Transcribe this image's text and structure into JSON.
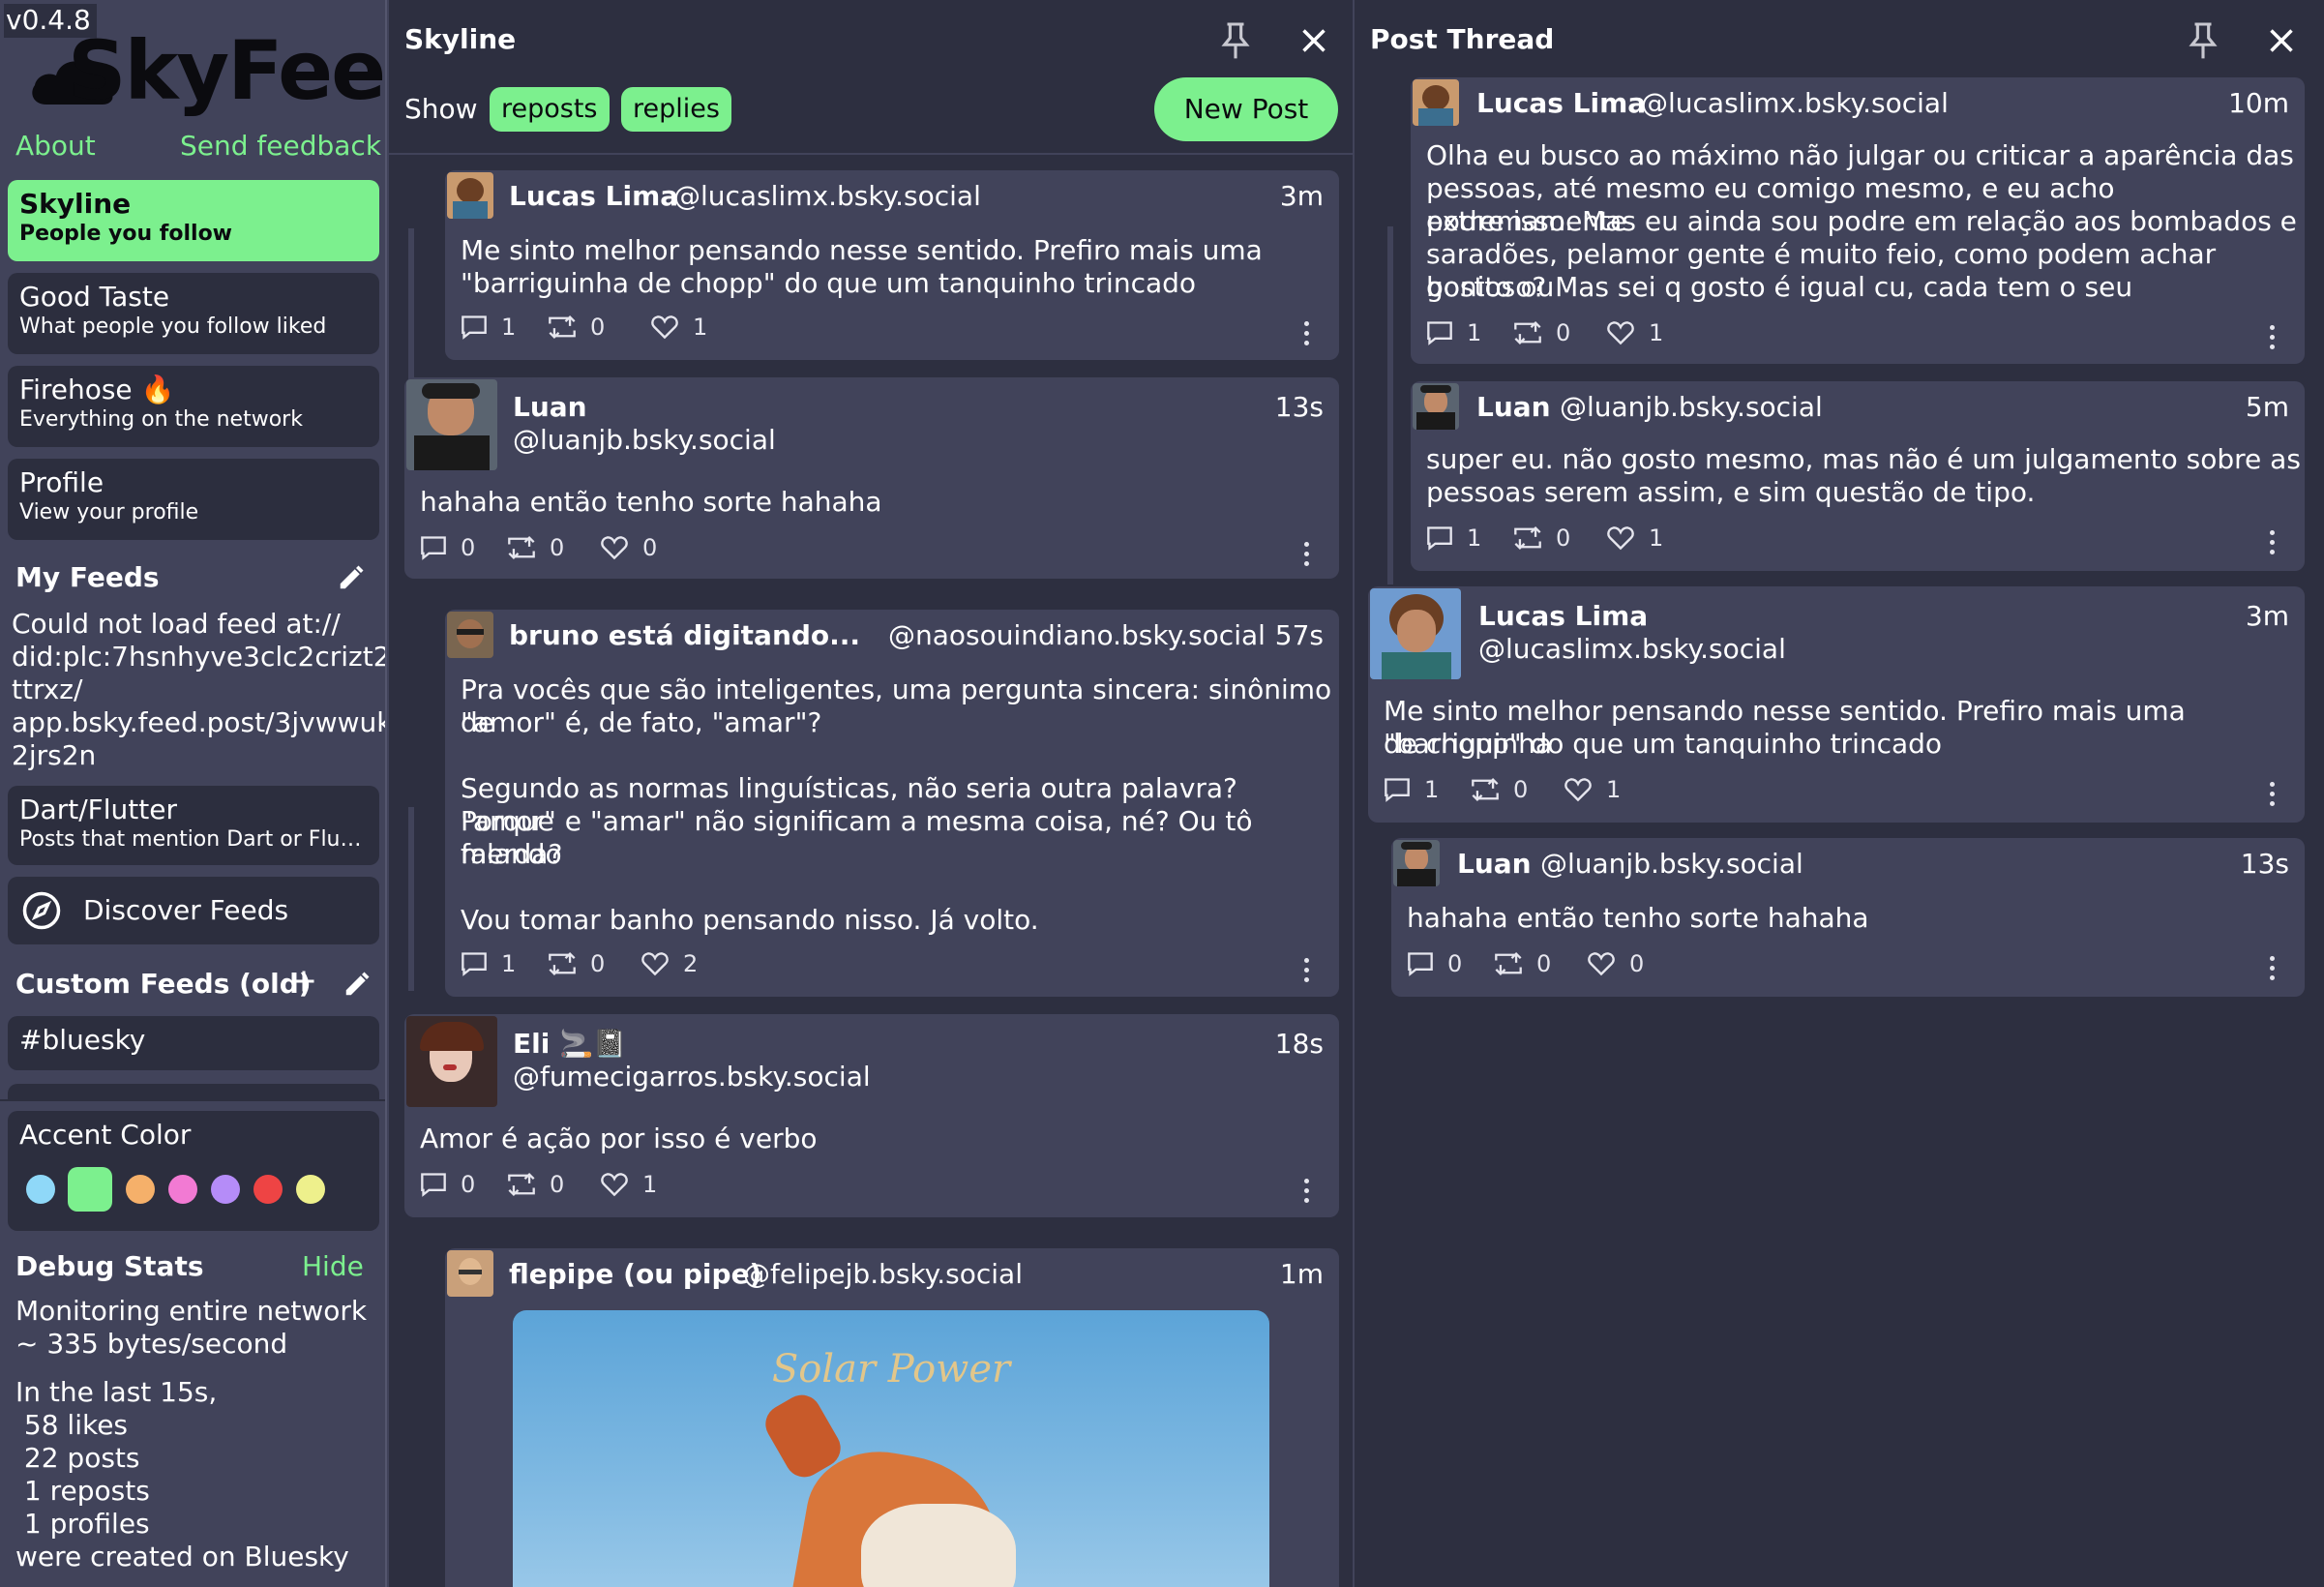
{
  "app": {
    "version": "v0.4.8",
    "logo_text": "SkyFeed",
    "accent_color": "#7cf08e"
  },
  "sidebar": {
    "about": "About",
    "send_feedback": "Send feedback",
    "feeds": [
      {
        "title": "Skyline",
        "subtitle": "People you follow",
        "active": true
      },
      {
        "title": "Good Taste",
        "subtitle": "What people you follow liked"
      },
      {
        "title": "Firehose 🔥",
        "subtitle": "Everything on the network"
      },
      {
        "title": "Profile",
        "subtitle": "View your profile"
      }
    ],
    "my_feeds_title": "My Feeds",
    "feed_error": [
      "Could not load feed at://",
      "did:plc:7hsnhyve3clc2crizt2",
      "ttrxz/",
      "app.bsky.feed.post/3jvwwuk",
      "2jrs2n"
    ],
    "dart_feed": {
      "title": "Dart/Flutter",
      "subtitle": "Posts that mention Dart or Flutt..."
    },
    "discover_feeds": "Discover Feeds",
    "custom_feeds_title": "Custom Feeds (old)",
    "custom_feed_item": "#bluesky",
    "accent_title": "Accent Color",
    "accent_colors": [
      "#8fd8f8",
      "#7cf08e",
      "#f5b06a",
      "#f27ad3",
      "#b58cf8",
      "#ee4444",
      "#eef08c"
    ],
    "debug_title": "Debug Stats",
    "debug_hide": "Hide",
    "debug_lines_1": [
      "Monitoring entire network",
      "~ 335 bytes/second"
    ],
    "debug_lines_2": [
      "In the last 15s,",
      " 58 likes",
      " 22 posts",
      " 1 reposts",
      " 1 profiles",
      "were created on Bluesky"
    ]
  },
  "skyline": {
    "title": "Skyline",
    "show_label": "Show",
    "filter_reposts": "reposts",
    "filter_replies": "replies",
    "new_post": "New Post",
    "posts": [
      {
        "name": "Lucas Lima",
        "handle": "@lucaslimx.bsky.social",
        "time": "3m",
        "lines": [
          "Me sinto melhor pensando nesse sentido. Prefiro mais uma",
          "\"barriguinha de chopp\" do que um tanquinho trincado"
        ],
        "replies": "1",
        "reposts": "0",
        "likes": "1"
      },
      {
        "name": "Luan",
        "handle": "@luanjb.bsky.social",
        "time": "13s",
        "lines": [
          "hahaha então tenho sorte hahaha"
        ],
        "replies": "0",
        "reposts": "0",
        "likes": "0"
      },
      {
        "name": "bruno está digitando...",
        "handle": "@naosouindiano.bsky.social",
        "time": "57s",
        "lines": [
          "Pra vocês que são inteligentes, uma pergunta sincera: sinônimo de",
          "\"amor\" é, de fato, \"amar\"?",
          "",
          "Segundo as normas linguísticas, não seria outra palavra? Porque",
          "\"amor\" e \"amar\" não significam a mesma coisa, né? Ou tô falando",
          "merda?",
          "",
          "Vou tomar banho pensando nisso. Já volto."
        ],
        "replies": "1",
        "reposts": "0",
        "likes": "2"
      },
      {
        "name": "Eli 🚬📓",
        "handle": "@fumecigarros.bsky.social",
        "time": "18s",
        "lines": [
          "Amor é ação por isso é verbo"
        ],
        "replies": "0",
        "reposts": "0",
        "likes": "1"
      },
      {
        "name": "flepipe (ou pipe)",
        "handle": "@felipejb.bsky.social",
        "time": "1m",
        "image_caption": "Solar Power"
      }
    ]
  },
  "thread": {
    "title": "Post Thread",
    "posts": [
      {
        "name": "Lucas Lima",
        "handle": "@lucaslimx.bsky.social",
        "time": "10m",
        "lines": [
          "Olha eu busco ao máximo não julgar ou criticar a aparência das",
          "pessoas, até mesmo eu comigo mesmo, e eu acho extremamente",
          "podre isso. Mas eu ainda sou podre em relação aos bombados e",
          "saradões, pelamor gente é muito feio, como podem achar bonito ou",
          "gostoso? Mas sei q gosto é igual cu, cada tem o seu"
        ],
        "replies": "1",
        "reposts": "0",
        "likes": "1"
      },
      {
        "name": "Luan",
        "handle": "@luanjb.bsky.social",
        "time": "5m",
        "lines": [
          "super eu. não gosto mesmo, mas não é um julgamento sobre as",
          "pessoas serem assim, e sim questão de tipo."
        ],
        "replies": "1",
        "reposts": "0",
        "likes": "1"
      },
      {
        "name": "Lucas Lima",
        "handle": "@lucaslimx.bsky.social",
        "time": "3m",
        "lines": [
          "Me sinto melhor pensando nesse sentido. Prefiro mais uma \"barriguinha",
          "de chopp\" do que um tanquinho trincado"
        ],
        "replies": "1",
        "reposts": "0",
        "likes": "1"
      },
      {
        "name": "Luan",
        "handle": "@luanjb.bsky.social",
        "time": "13s",
        "lines": [
          "hahaha então tenho sorte hahaha"
        ],
        "replies": "0",
        "reposts": "0",
        "likes": "0"
      }
    ]
  }
}
